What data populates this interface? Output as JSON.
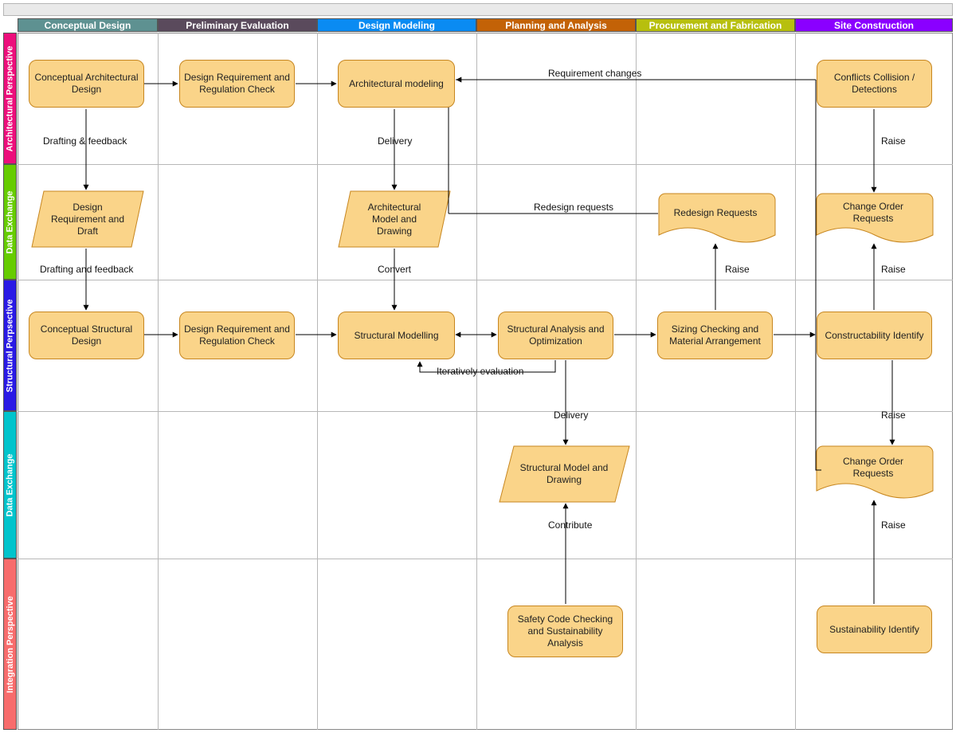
{
  "columns": [
    {
      "label": "Conceptual Design",
      "color": "#5e9191"
    },
    {
      "label": "Preliminary Evaluation",
      "color": "#5a4a5c"
    },
    {
      "label": "Design Modeling",
      "color": "#0a8bf2"
    },
    {
      "label": "Planning and Analysis",
      "color": "#c36207"
    },
    {
      "label": "Procurement and Fabrication",
      "color": "#b7bf0e"
    },
    {
      "label": "Site Construction",
      "color": "#8a00ff"
    }
  ],
  "rows": [
    {
      "label": "Architectural Perspective",
      "color": "#ec0e7b"
    },
    {
      "label": "Data Exchange",
      "color": "#66cc00"
    },
    {
      "label": "Structural Perpsective",
      "color": "#2a1ae5"
    },
    {
      "label": "Data Exchange",
      "color": "#00c4cc"
    },
    {
      "label": "Integration Perspective",
      "color": "#f76c6c"
    }
  ],
  "nodes": {
    "n1": "Conceptual Architectural Design",
    "n2": "Design Requirement and Regulation Check",
    "n3": "Architectural modeling",
    "n4": "Conflicts Collision / Detections",
    "n5": "Design Requirement and Draft",
    "n6": "Architectural Model and Drawing",
    "n7": "Redesign Requests",
    "n8": "Change Order Requests",
    "n9": "Conceptual Structural Design",
    "n10": "Design Requirement and Regulation Check",
    "n11": "Structural Modelling",
    "n12": "Structural Analysis and Optimization",
    "n13": "Sizing Checking and Material Arrangement",
    "n14": "Constructability Identify",
    "n15": "Structural Model and Drawing",
    "n16": "Change Order Requests",
    "n17": "Safety Code Checking and Sustainability Analysis",
    "n18": "Sustainability Identify"
  },
  "labels": {
    "l1": "Drafting & feedback",
    "l2": "Delivery",
    "l3": "Requirement changes",
    "l4": "Raise",
    "l5": "Drafting and feedback",
    "l6": "Convert",
    "l7": "Redesign requests",
    "l8": "Raise",
    "l9": "Raise",
    "l10": "Iteratively evaluation",
    "l11": "Delivery",
    "l12": "Raise",
    "l13": "Contribute",
    "l14": "Raise"
  }
}
